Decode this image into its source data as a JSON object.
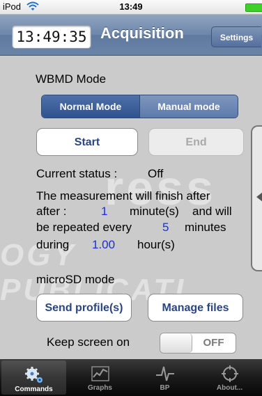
{
  "status_bar": {
    "device": "iPod",
    "time": "13:49"
  },
  "nav": {
    "clock": "13:49:35",
    "title": "Acquisition",
    "settings_label": "Settings"
  },
  "wbmd": {
    "heading": "WBMD Mode",
    "segments": [
      "Normal Mode",
      "Manual mode"
    ],
    "start_label": "Start",
    "end_label": "End",
    "status_label": "Current status :",
    "status_value": "Off",
    "line1": "The measurement will finish after",
    "after": "after :",
    "minutes_value": "1",
    "minute_unit": "minute(s)",
    "and_will": "and will",
    "repeated": "be repeated every",
    "repeat_value": "5",
    "minutes_word": "minutes",
    "during": "during",
    "hours_value": "1.00",
    "hours_unit": "hour(s)"
  },
  "microsd": {
    "heading": "microSD mode",
    "send_label": "Send profile(s)",
    "manage_label": "Manage files"
  },
  "keep_screen": {
    "label": "Keep screen on",
    "toggle_state": "OFF"
  },
  "watermark": {
    "line1": "SCIENCE AND TECHNOLOGY PUBLICATIONS"
  },
  "tabs": [
    {
      "label": "Commands",
      "icon": "gears-icon"
    },
    {
      "label": "Graphs",
      "icon": "graph-icon"
    },
    {
      "label": "BP",
      "icon": "pulse-icon"
    },
    {
      "label": "About...",
      "icon": "crosshair-icon"
    }
  ],
  "colors": {
    "nav_blue": "#6d87aa",
    "value_blue": "#1a2fd8",
    "battery_green": "#3ed12a"
  }
}
